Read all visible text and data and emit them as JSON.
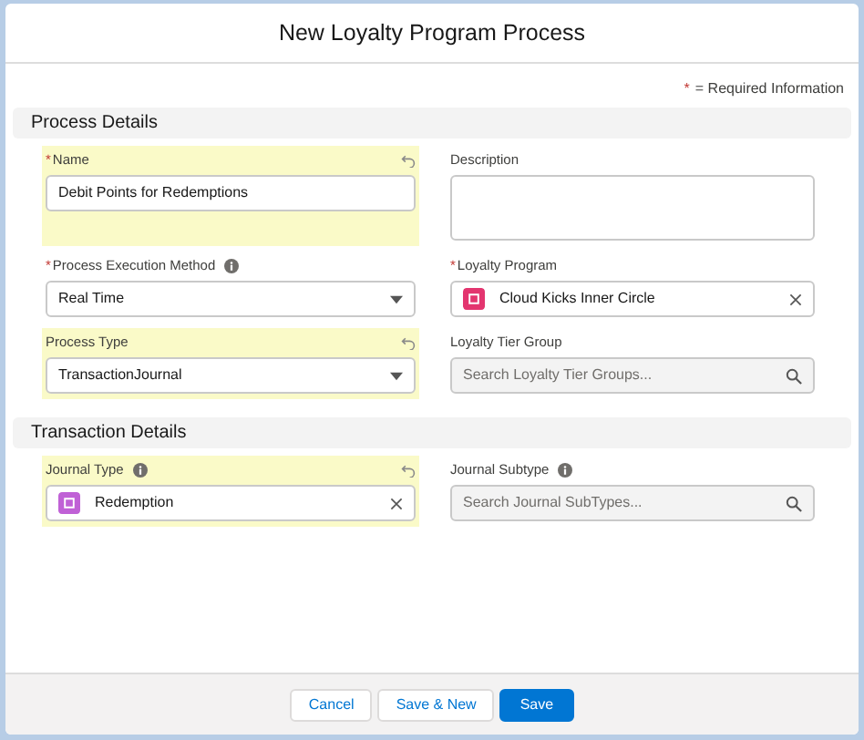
{
  "window": {
    "title": "New Loyalty Program Process"
  },
  "required_note": {
    "mark": "*",
    "text": "= Required Information"
  },
  "sections": [
    {
      "title": "Process Details",
      "fields": [
        {
          "kind": "text",
          "label": "Name",
          "required": true,
          "info": false,
          "edited": true,
          "value": "Debit Points for Redemptions"
        },
        {
          "kind": "textarea",
          "label": "Description",
          "required": false,
          "info": false,
          "edited": false
        },
        {
          "kind": "select",
          "label": "Process Execution Method",
          "required": true,
          "info": true,
          "edited": false,
          "value": "Real Time"
        },
        {
          "kind": "lookup",
          "label": "Loyalty Program",
          "required": true,
          "info": false,
          "edited": false,
          "value": "Cloud Kicks Inner Circle",
          "color": "#e3356f"
        },
        {
          "kind": "select",
          "label": "Process Type",
          "required": false,
          "info": false,
          "edited": true,
          "value": "TransactionJournal"
        },
        {
          "kind": "search",
          "label": "Loyalty Tier Group",
          "required": false,
          "info": false,
          "edited": false,
          "placeholder": "Search Loyalty Tier Groups..."
        }
      ]
    },
    {
      "title": "Transaction Details",
      "fields": [
        {
          "kind": "lookup",
          "label": "Journal Type",
          "required": false,
          "info": true,
          "edited": true,
          "value": "Redemption",
          "color": "#c061d6"
        },
        {
          "kind": "search",
          "label": "Journal Subtype",
          "required": false,
          "info": true,
          "edited": false,
          "placeholder": "Search Journal SubTypes..."
        }
      ]
    }
  ],
  "buttons": [
    {
      "label": "Cancel",
      "kind": "neutral"
    },
    {
      "label": "Save & New",
      "kind": "neutral"
    },
    {
      "label": "Save",
      "kind": "brand"
    }
  ]
}
